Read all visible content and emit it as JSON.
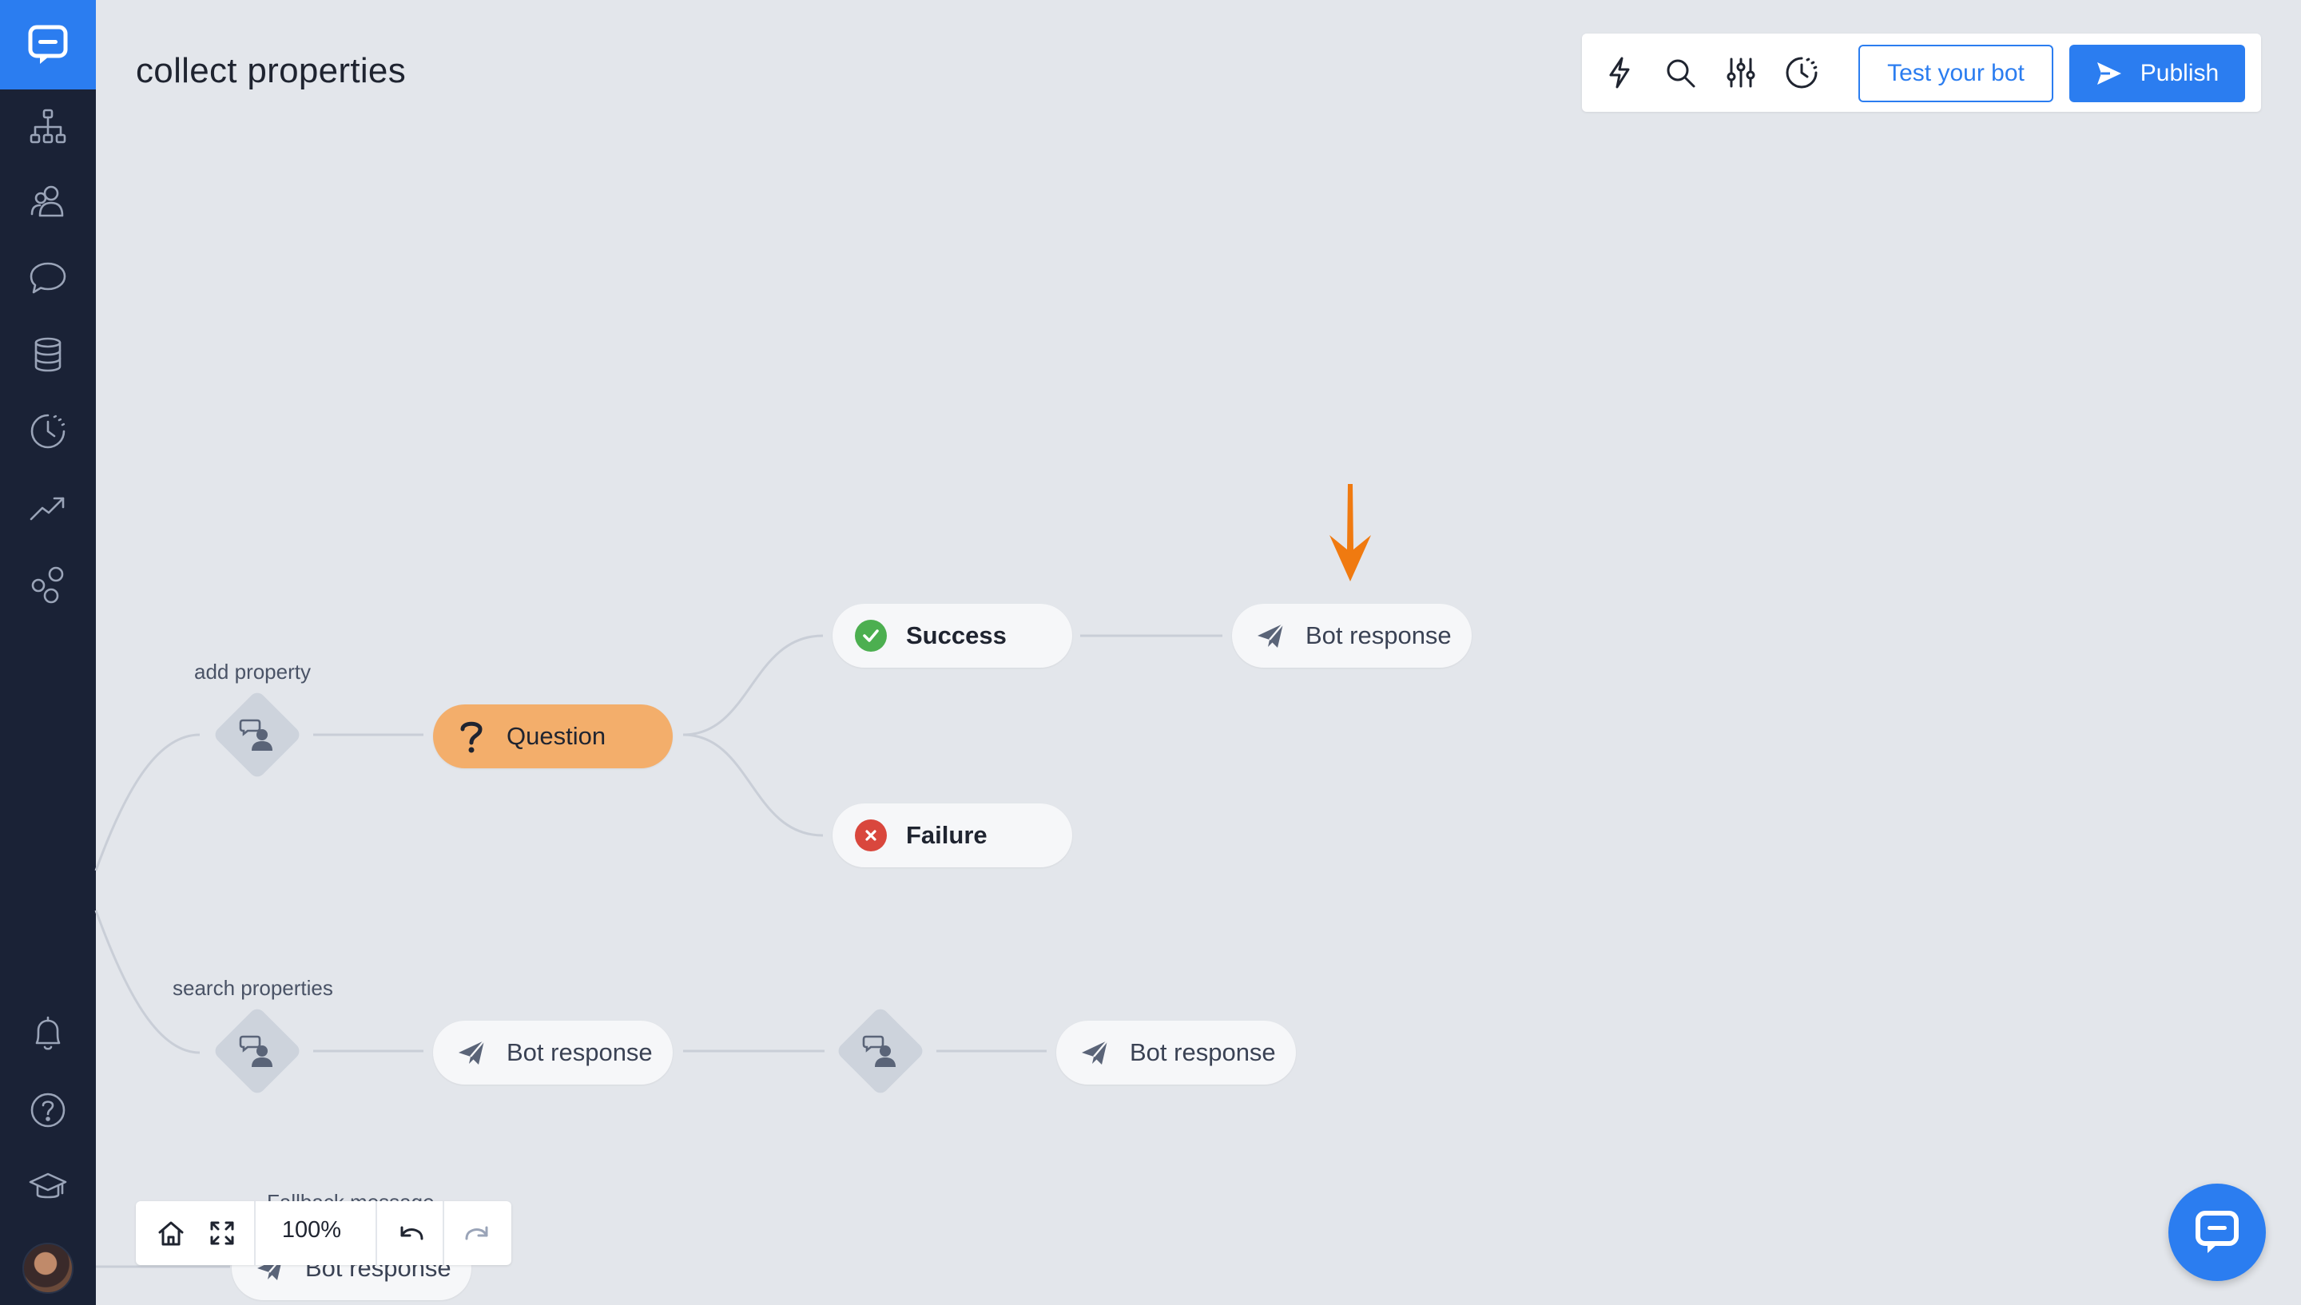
{
  "page": {
    "title": "collect properties"
  },
  "sidebar": {
    "items": [
      {
        "name": "flow",
        "icon": "sitemap-icon"
      },
      {
        "name": "users",
        "icon": "users-icon"
      },
      {
        "name": "chat",
        "icon": "chat-bubble-icon"
      },
      {
        "name": "data",
        "icon": "database-icon"
      },
      {
        "name": "history",
        "icon": "history-icon"
      },
      {
        "name": "reports",
        "icon": "trending-icon"
      },
      {
        "name": "integrations",
        "icon": "bubbles-icon"
      },
      {
        "name": "notifications",
        "icon": "bell-icon"
      },
      {
        "name": "help",
        "icon": "question-circle-icon"
      },
      {
        "name": "academy",
        "icon": "graduation-cap-icon"
      }
    ]
  },
  "toolbar": {
    "test_label": "Test your bot",
    "publish_label": "Publish"
  },
  "flow": {
    "intents": [
      {
        "label": "add property"
      },
      {
        "label": "search properties"
      },
      {
        "label": "Fallback message"
      }
    ],
    "nodes": {
      "question": "Question",
      "success": "Success",
      "failure": "Failure",
      "bot_response_top": "Bot response",
      "bot_response_mid_1": "Bot response",
      "bot_response_mid_2": "Bot response",
      "bot_response_bottom": "Bot response"
    }
  },
  "controls": {
    "zoom": "100%"
  },
  "colors": {
    "sidebar": "#1a2236",
    "accent": "#2b7df0",
    "question": "#f3ae6b",
    "success": "#4caf50",
    "failure": "#d9473d",
    "annotation_arrow": "#f07a10"
  }
}
